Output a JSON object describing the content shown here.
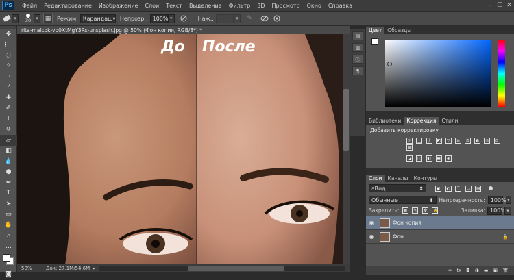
{
  "app": {
    "logo": "Ps"
  },
  "menu": {
    "items": [
      "Файл",
      "Редактирование",
      "Изображение",
      "Слои",
      "Текст",
      "Выделение",
      "Фильтр",
      "3D",
      "Просмотр",
      "Окно",
      "Справка"
    ],
    "window_controls": [
      "–",
      "☐",
      "✕"
    ]
  },
  "options": {
    "brush_size": "30",
    "mode_label": "Режим:",
    "mode_value": "Карандаш",
    "opacity_label": "Непрозр.:",
    "opacity_value": "100%",
    "pressure_label": "Наж.:",
    "pressure_value": ""
  },
  "document": {
    "tab_title": "rita-malcok-vb0XtMgY3Rs-unsplash.jpg @ 50% (Фон копия, RGB/8*) *",
    "before_label": "До",
    "after_label": "После"
  },
  "status": {
    "zoom": "50%",
    "doc_info": "Док: 27,1M/54,6M"
  },
  "panels": {
    "color": {
      "tabs": [
        "Цвет",
        "Образцы"
      ]
    },
    "adjustments": {
      "tabs": [
        "Библиотеки",
        "Коррекция",
        "Стили"
      ],
      "title": "Добавить корректировку"
    },
    "layers": {
      "tabs": [
        "Слои",
        "Каналы",
        "Контуры"
      ],
      "filter_kind": "Вид",
      "blend_mode": "Обычные",
      "opacity_label": "Непрозрачность:",
      "opacity_value": "100%",
      "lock_label": "Закрепить:",
      "fill_label": "Заливка:",
      "fill_value": "100%",
      "items": [
        {
          "name": "Фон копия",
          "selected": true
        },
        {
          "name": "Фон",
          "selected": false
        }
      ]
    }
  },
  "colors": {
    "accent": "#5b8bd6",
    "hue_red": "#ff0000",
    "picker_blue": "#0066ff"
  }
}
